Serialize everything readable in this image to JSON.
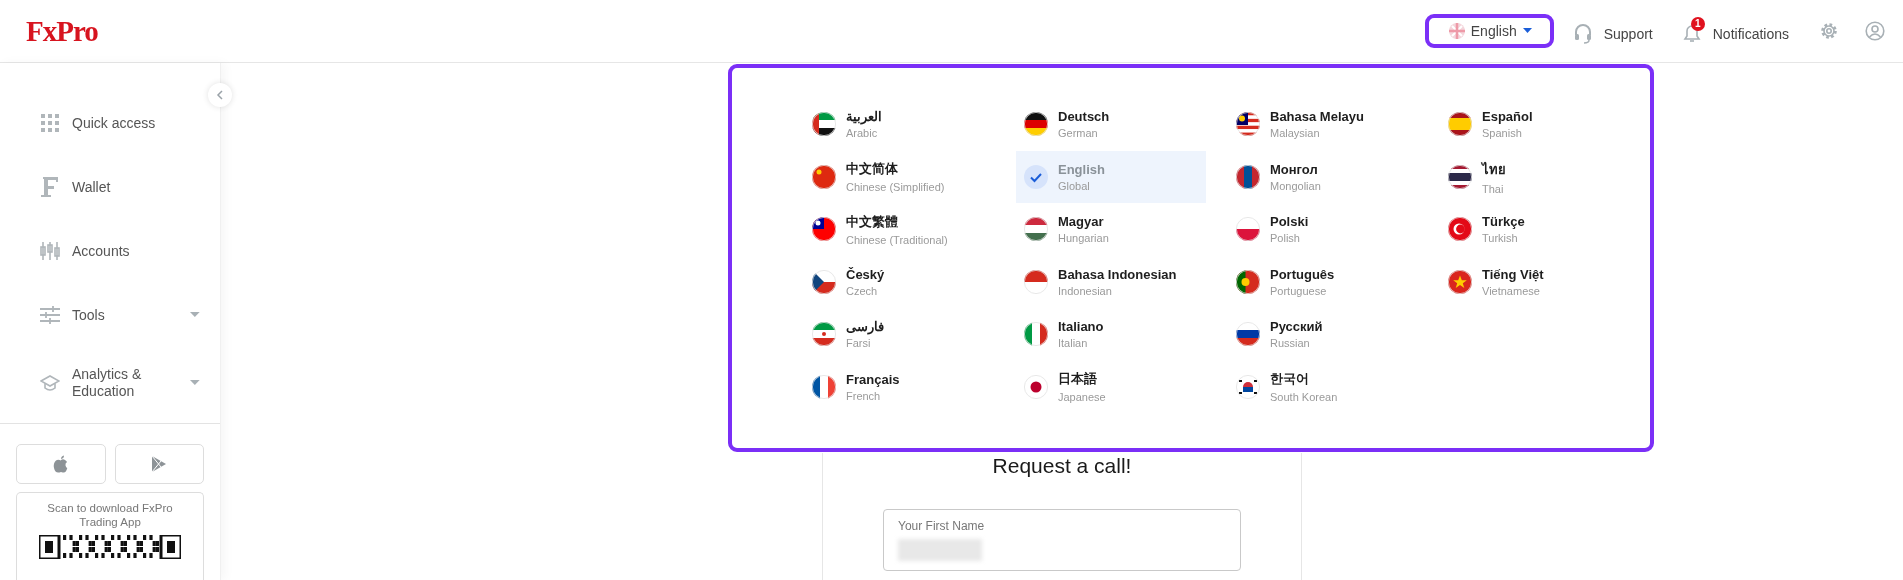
{
  "header": {
    "logo": "FxPro",
    "language_button": {
      "label": "English",
      "expanded": true
    },
    "support": "Support",
    "notifications": {
      "label": "Notifications",
      "badge": "1"
    }
  },
  "sidebar": {
    "items": [
      {
        "label": "Quick access",
        "submenu": false
      },
      {
        "label": "Wallet",
        "submenu": false
      },
      {
        "label": "Accounts",
        "submenu": false
      },
      {
        "label": "Tools",
        "submenu": true
      },
      {
        "label": "Analytics & Education",
        "submenu": true
      }
    ],
    "app_download": {
      "text": "Scan to download FxPro Trading App"
    }
  },
  "language_menu": {
    "items": [
      {
        "name": "العربية",
        "subtitle": "Arabic",
        "selected": false
      },
      {
        "name": "中文简体",
        "subtitle": "Chinese (Simplified)",
        "selected": false
      },
      {
        "name": "中文繁體",
        "subtitle": "Chinese (Traditional)",
        "selected": false
      },
      {
        "name": "Český",
        "subtitle": "Czech",
        "selected": false
      },
      {
        "name": "فارسی",
        "subtitle": "Farsi",
        "selected": false
      },
      {
        "name": "Français",
        "subtitle": "French",
        "selected": false
      },
      {
        "name": "Deutsch",
        "subtitle": "German",
        "selected": false
      },
      {
        "name": "English",
        "subtitle": "Global",
        "selected": true
      },
      {
        "name": "Magyar",
        "subtitle": "Hungarian",
        "selected": false
      },
      {
        "name": "Bahasa Indonesian",
        "subtitle": "Indonesian",
        "selected": false
      },
      {
        "name": "Italiano",
        "subtitle": "Italian",
        "selected": false
      },
      {
        "name": "日本語",
        "subtitle": "Japanese",
        "selected": false
      },
      {
        "name": "Bahasa Melayu",
        "subtitle": "Malaysian",
        "selected": false
      },
      {
        "name": "Монгол",
        "subtitle": "Mongolian",
        "selected": false
      },
      {
        "name": "Polski",
        "subtitle": "Polish",
        "selected": false
      },
      {
        "name": "Português",
        "subtitle": "Portuguese",
        "selected": false
      },
      {
        "name": "Русский",
        "subtitle": "Russian",
        "selected": false
      },
      {
        "name": "한국어",
        "subtitle": "South Korean",
        "selected": false
      },
      {
        "name": "Español",
        "subtitle": "Spanish",
        "selected": false
      },
      {
        "name": "ไทย",
        "subtitle": "Thai",
        "selected": false
      },
      {
        "name": "Türkçe",
        "subtitle": "Turkish",
        "selected": false
      },
      {
        "name": "Tiếng Việt",
        "subtitle": "Vietnamese",
        "selected": false
      }
    ]
  },
  "request_form": {
    "title": "Request a call!",
    "fields": [
      {
        "label": "Your First Name"
      }
    ]
  }
}
